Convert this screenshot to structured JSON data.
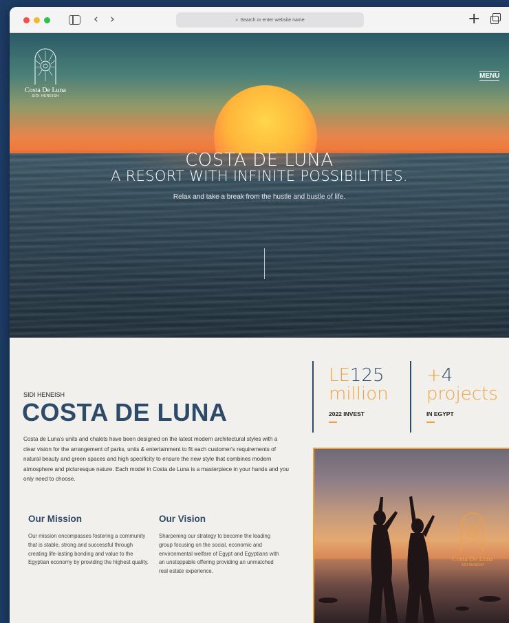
{
  "browser": {
    "address_placeholder": "Search or enter website name"
  },
  "header": {
    "logo_name": "Costa De Luna",
    "logo_sub": "SIDI HENEISH",
    "menu_label": "MENU"
  },
  "hero": {
    "title": "COSTA DE LUNA",
    "subtitle": "A RESORT WITH INFINITE POSSIBILITIES.",
    "tagline": "Relax and take a break from the hustle and bustle of life."
  },
  "intro": {
    "eyebrow": "SIDI HENEISH",
    "title": "COSTA DE LUNA",
    "description": "Costa de Luna's units and chalets have been designed on the latest modern architectural styles with a clear vision for the arrangement of parks, units & entertainment to fit each customer's requirements of natural beauty and green spaces and high specificity to ensure the new style that combines modern atmosphere and picturesque nature. Each model in Costa de Luna is a masterpiece in your hands and you only need to choose."
  },
  "mission": {
    "title": "Our Mission",
    "text": "Our mission encompasses fostering a community that is stable, strong and successful through creating life-lasting bonding and value to the Egyptian economy by providing the highest quality."
  },
  "vision": {
    "title": "Our Vision",
    "text": "Sharpening our strategy to become the leading group focusing on the social, economic and environmental welfare of Egypt and Egyptians with an unstoppable offering providing an unmatched real estate experience."
  },
  "stats": [
    {
      "prefix": "LE",
      "number": "125",
      "unit": "million",
      "label": "2022 INVEST"
    },
    {
      "prefix": "+",
      "number": "4",
      "unit": "projects",
      "label": "IN EGYPT"
    }
  ],
  "photo": {
    "logo_name": "Costa De Luna",
    "logo_sub": "SIDI HENEISH"
  },
  "colors": {
    "navy": "#2d4a68",
    "accent_orange": "#f0a13a",
    "page_bg": "#f1f0ec"
  }
}
